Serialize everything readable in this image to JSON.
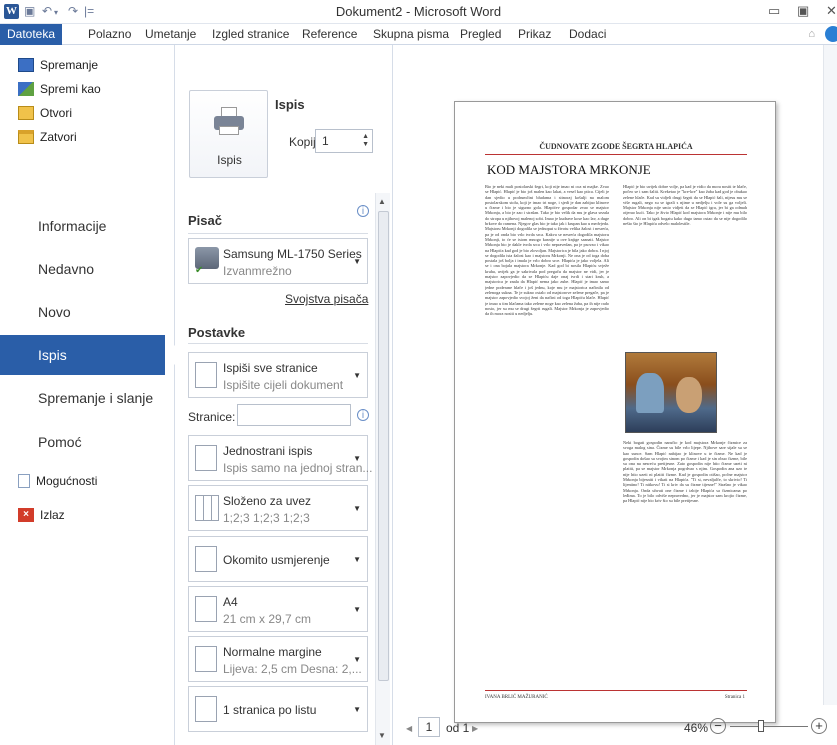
{
  "window": {
    "title": "Dokument2 - Microsoft Word",
    "app_icon_letter": "W"
  },
  "quick_access": {
    "undo": "↶",
    "redo": "↷"
  },
  "ribbon_tabs": [
    "Datoteka",
    "Polazno",
    "Umetanje",
    "Izgled stranice",
    "Reference",
    "Skupna pisma",
    "Pregled",
    "Prikaz",
    "Dodaci"
  ],
  "nav": {
    "commands": [
      "Spremanje",
      "Spremi kao",
      "Otvori",
      "Zatvori"
    ],
    "items": [
      "Informacije",
      "Nedavno",
      "Novo",
      "Ispis",
      "Spremanje i slanje",
      "Pomoć"
    ],
    "bottom_commands": [
      "Mogućnosti",
      "Izlaz"
    ]
  },
  "print": {
    "button_label": "Ispis",
    "heading": "Ispis",
    "copies_label": "Kopije:",
    "copies_value": "1",
    "printer_heading": "Pisač",
    "printer_name": "Samsung ML-1750 Series",
    "printer_status": "Izvanmrežno",
    "printer_props": "Svojstva pisača",
    "settings_heading": "Postavke",
    "pages_label": "Stranice:",
    "pages_value": "",
    "settings": [
      {
        "l1": "Ispiši sve stranice",
        "l2": "Ispišite cijeli dokument"
      },
      {
        "l1": "Jednostrani ispis",
        "l2": "Ispis samo na jednoj stran..."
      },
      {
        "l1": "Složeno za uvez",
        "l2": "1;2;3   1;2;3   1;2;3"
      },
      {
        "l1": "Okomito usmjerenje",
        "l2": ""
      },
      {
        "l1": "A4",
        "l2": "21 cm x 29,7 cm"
      },
      {
        "l1": "Normalne margine",
        "l2": "Lijeva: 2,5 cm   Desna: 2,..."
      },
      {
        "l1": "1 stranica po listu",
        "l2": ""
      }
    ]
  },
  "preview": {
    "header": "ČUDNOVATE ZGODE ŠEGRTA HLAPIĆA",
    "title": "KOD MAJSTORA MRKONJE",
    "col1": "Bio je neki mali postolarski šegrt, koji nije imao ni oca ni majke. Zvao se Hlapić. Hlapić je bio još malen kao lakat, a vesel kao ptica. Cijeli je dan sjedio u podrumčini bludama i sitnoraj košulji na malom postolarskom stolu, koji je imao tri noge, i sjedi je dan zabijao klinove u čizme i bio je sigurno gola. Hlapićev gospodar zvao se majstor Mrkonja, a bio je zao i strašan. Tako je bio velik da mu je glava sezala do stropa u njihovoj malenoj sobi. Imao je kudrave kose kao lav, a duge brkove do ramena. Njegov glas bio je tako jak i krupan kao u medvjeda. Majstoru Mrkonji dogodila se jednoput u životu velika žalost i nesreća, pa je od onda bio vrlo tvrda srca. Kakva se nesreća dogodila majstoru Mrkonji, to će se istom mnogo kasnije u ove knjige saznati. Majstor Mrkonja bio je dakle tvrda srca i vrlo nepravedan, pa je psovao i vikao na Hlapića kad god je bio zlovoljan. Majstorica je bila jako dobra. I njoj se dogodila ista žalost kao i majstoru Mrkonji. Ne ona je od toga doba postala još bolja i imala je vrlo dobro srce. Hlapića je jako voljela. Ali se i ona bojala majstora Mrkonje. Kad god bi nosila Hlapiću svježe kruha, uvijek ga je sakrivala pod pregaču da majstor ne vidi, jer je majstor zapovjedio da se Hlapiću daje onaj tvrdi i stari kruh, a majstorica je znala da Hlapić nema jako zube. Hlapić je imao samo jedne poderane hlače i još jednu, koje mu je majstorica načinila od zelenoga sukna. Te je sukno ostalo od majstorove zelene pregače, pa je majstor zapovjedio svojoj ženi da načini od toga Hlapiću hlače. Hlapić je imao u tim hlačama tako zelene noge kao zelena žaba, pa ih nije rado nosio, jer su mu se drugi šegrti rugali. Majstor Mrkonja je zapovjedio da ih mora nositi u nedjelju.",
    "col2a": "Hlapić je bio uvijek dobre volje, pa kad je vidio da mora nositi te hlače, počeo se i sam šaliti. Kreketao je \"kre-kre\" kao žaba kad god je obukao zelene hlače. Kad su vidjeli drugi šegrti da se Hlapić šali, nijesu mu se više rugali, nego su se igrali s njime u nedjelju i vole su ga voljeli. Majstor Mrkonja nije smio vidjeti da se Hlapić igra, jer bi ga odmah otjerao kući. Tako je živio Hlapić kod majstora Mrkonje i nije mu bilo dobro. Ali on bi igak bogatu kako dugo tamo ostao da se nije dogodilo nešto što je Hlapića odvelo malolestile.",
    "col2b": "Neki bogati gospodin naručio je kod majstora Mrkonje čizmice za svoga malog sina. Čizme su bile vrlo lijepe. Njihove sare sijale su se kao sunce. Sam Hlapić nabijao je klinove u te čizme. Ne kad je gospodin došao sa svojim sinom po čizme i kad je sin obuo čizme, bile su ona na nesreću pretijesne. Zato gospodin nije htio čizme uzeti ni platiti, pa se majstor Mrkonja pogrdvao s njim. Gospodin ana uzo te nije htio uzeti ni platiti čizme. Kad je gospodin otišao, počne majstor Mrkonja bijesniti i vikati na Hlapića. \"Ti si, nevaljalče, to skrivio! Ti lijentino! Ti nitkovu! Ti si kriv da su čizme tijesne!\" Strašno je vikao Mrkonja. Onda uhvati one čizme i izbije Hlapića sa čizmicama po leđima. To je bilo odviše nepravedno, jer je majstor sam krojio čizme, pa Hlapić nije bio kriv što su bile pretijesne.",
    "footer_left": "IVANA BRLIĆ MAŽURANIĆ",
    "footer_right": "Stranica 1",
    "current_page": "1",
    "of_pages": "od 1",
    "zoom": "46%"
  }
}
